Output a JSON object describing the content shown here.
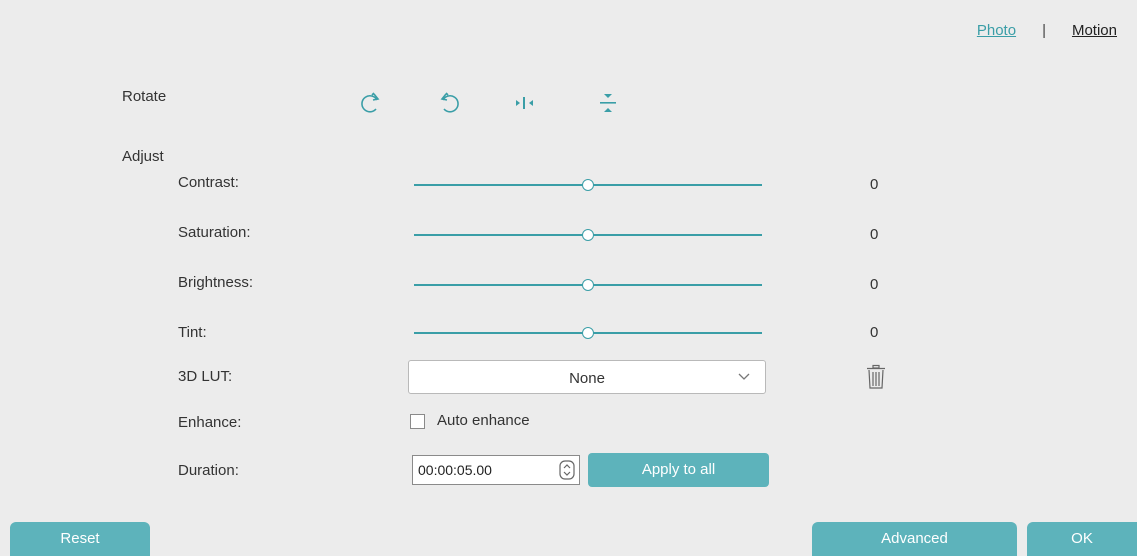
{
  "tabs": {
    "photo": "Photo",
    "separator": "|",
    "motion": "Motion"
  },
  "rotate": {
    "label": "Rotate"
  },
  "adjust": {
    "label": "Adjust",
    "sliders": [
      {
        "label": "Contrast:",
        "value": "0",
        "level": 0.5
      },
      {
        "label": "Saturation:",
        "value": "0",
        "level": 0.5
      },
      {
        "label": "Brightness:",
        "value": "0",
        "level": 0.5
      },
      {
        "label": "Tint:",
        "value": "0",
        "level": 0.5
      }
    ]
  },
  "lut": {
    "label": "3D LUT:",
    "selected": "None"
  },
  "enhance": {
    "label": "Enhance:",
    "checkbox_label": "Auto enhance",
    "checked": false
  },
  "duration": {
    "label": "Duration:",
    "value": "00:00:05.00",
    "apply_label": "Apply to all"
  },
  "buttons": {
    "reset": "Reset",
    "advanced": "Advanced",
    "ok": "OK"
  },
  "colors": {
    "accent": "#3a9ea7",
    "button": "#5db3bb",
    "background": "#ececec"
  }
}
